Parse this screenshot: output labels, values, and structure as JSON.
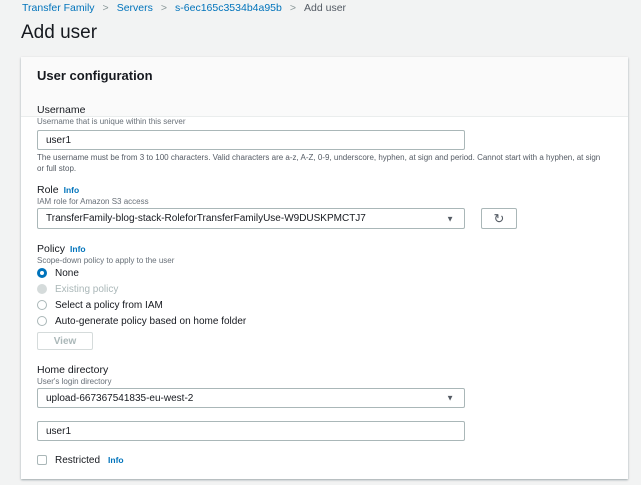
{
  "breadcrumb": [
    {
      "label": "Transfer Family"
    },
    {
      "label": "Servers"
    },
    {
      "label": "s-6ec165c3534b4a95b"
    },
    {
      "label": "Add user"
    }
  ],
  "page_title": "Add user",
  "panel": {
    "title": "User configuration",
    "username": {
      "label": "Username",
      "description": "Username that is unique within this server",
      "value": "user1",
      "help": "The username must be from 3 to 100 characters. Valid characters are a-z, A-Z, 0-9, underscore, hyphen, at sign and period. Cannot start with a hyphen, at sign or full stop."
    },
    "role": {
      "label": "Role",
      "info": "Info",
      "description": "IAM role for Amazon S3 access",
      "value": "TransferFamily-blog-stack-RoleforTransferFamilyUse-W9DUSKPMCTJ7"
    },
    "policy": {
      "label": "Policy",
      "info": "Info",
      "description": "Scope-down policy to apply to the user",
      "options": [
        {
          "label": "None",
          "selected": true
        },
        {
          "label": "Existing policy",
          "disabled": true
        },
        {
          "label": "Select a policy from IAM"
        },
        {
          "label": "Auto-generate policy based on home folder"
        }
      ],
      "view_label": "View"
    },
    "home": {
      "label": "Home directory",
      "description": "User's login directory",
      "bucket": "upload-667367541835-eu-west-2",
      "path": "user1",
      "restricted_label": "Restricted",
      "restricted_checked": false,
      "info": "Info"
    }
  }
}
